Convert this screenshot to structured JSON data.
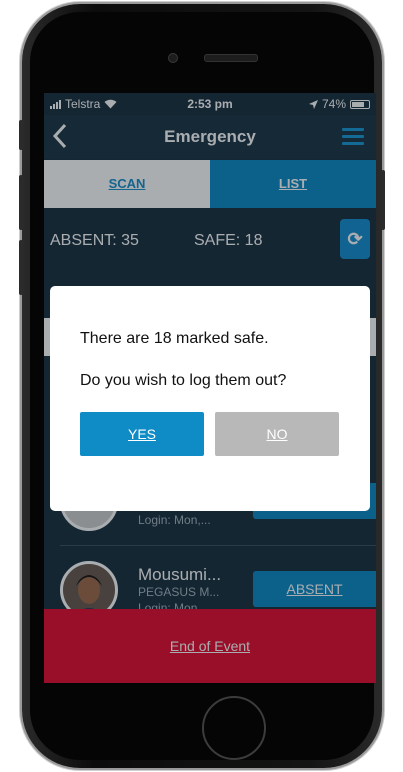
{
  "status_bar": {
    "carrier": "Telstra",
    "time": "2:53 pm",
    "battery": "74%"
  },
  "nav": {
    "title": "Emergency",
    "back_icon": "chevron-left-icon",
    "menu_icon": "hamburger-menu-icon"
  },
  "tabs": [
    {
      "label": "SCAN"
    },
    {
      "label": "LIST"
    }
  ],
  "counts": {
    "absent": "ABSENT: 35",
    "safe": "SAFE: 18"
  },
  "rows": [
    {
      "name": "",
      "sub": "",
      "login": "Login: Mon,...",
      "button": ""
    },
    {
      "name": "Mousumi...",
      "sub": "PEGASUS M...",
      "login": "Login: Mon,...",
      "button": "ABSENT"
    }
  ],
  "footer": {
    "label": "End of Event"
  },
  "dialog": {
    "message": "There are 18 marked safe.",
    "question": "Do you wish to log them out?",
    "yes": "YES",
    "no": "NO"
  },
  "colors": {
    "accent": "#0f8bc6",
    "background": "#1c3040",
    "danger": "#e60b2e"
  }
}
